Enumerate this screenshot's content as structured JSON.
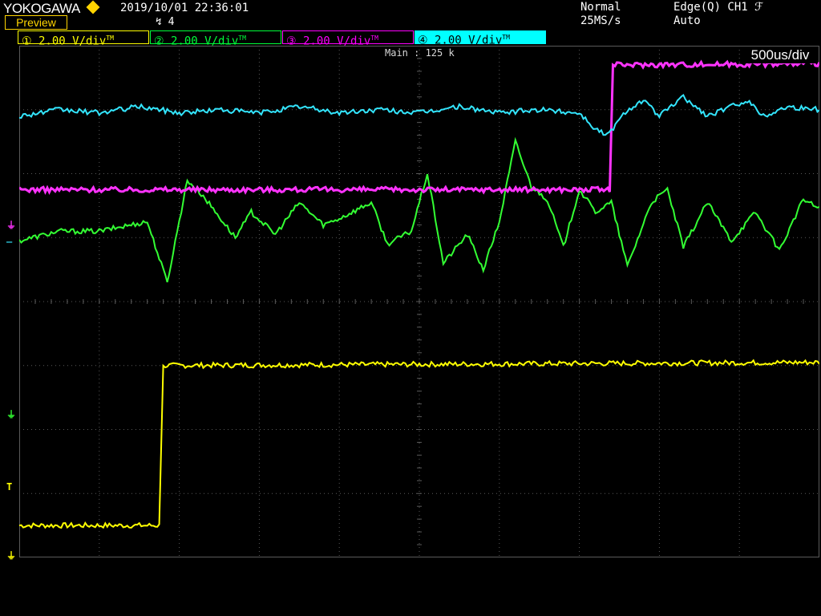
{
  "header": {
    "brand": "YOKOGAWA",
    "datetime": "2019/10/01 22:36:01",
    "mode_label": "Preview",
    "trigger_count": "↯ 4",
    "acq_mode": "Normal",
    "sample_rate": "25MS/s",
    "trigger_type": "Edge(Q) CH1 ℱ",
    "trigger_mode": "Auto"
  },
  "channels": [
    {
      "num": "①",
      "scale": "2.00 V/div",
      "color": "#ffff00"
    },
    {
      "num": "②",
      "scale": "2.00 V/div",
      "color": "#00ff3a"
    },
    {
      "num": "③",
      "scale": "2.00 V/div",
      "color": "#ff00ff"
    },
    {
      "num": "④",
      "scale": "2.00 V/div",
      "color": "#00ffff"
    }
  ],
  "channel_suffix": "TM",
  "display": {
    "main_label": "Main : 125 k",
    "time_div": "500us/div"
  },
  "colors": {
    "ch1": "#ffff00",
    "ch2": "#33ff33",
    "ch3": "#ff33ff",
    "ch4": "#33e6ff",
    "grid": "#5a5a5a",
    "brand": "#ffd400"
  },
  "chart_data": {
    "type": "line",
    "x_divisions": 10,
    "y_divisions": 8,
    "grid": true,
    "series": [
      {
        "x": [
          0,
          1.75,
          1.8,
          10
        ],
        "y": [
          -3.5,
          -3.5,
          -1.0,
          -0.95
        ]
      },
      {
        "x": [
          0,
          0.5,
          1.0,
          1.6,
          1.85,
          2.1,
          2.3,
          2.7,
          2.9,
          3.2,
          3.5,
          3.8,
          4.0,
          4.4,
          4.6,
          4.9,
          5.1,
          5.3,
          5.6,
          5.8,
          6.0,
          6.2,
          6.4,
          6.6,
          6.8,
          7.0,
          7.2,
          7.4,
          7.6,
          7.9,
          8.1,
          8.3,
          8.6,
          8.9,
          9.2,
          9.5,
          9.8,
          10
        ],
        "y": [
          0.95,
          1.1,
          1.1,
          1.25,
          0.3,
          1.9,
          1.65,
          1.0,
          1.4,
          1.05,
          1.55,
          1.2,
          1.3,
          1.55,
          0.9,
          1.1,
          2.0,
          0.6,
          1.05,
          0.5,
          1.25,
          2.5,
          1.8,
          1.6,
          0.85,
          1.75,
          1.4,
          1.55,
          0.55,
          1.55,
          1.75,
          0.85,
          1.55,
          0.95,
          1.4,
          0.8,
          1.6,
          1.45
        ]
      },
      {
        "x": [
          0,
          7.38,
          7.42,
          10
        ],
        "y": [
          1.75,
          1.75,
          3.7,
          3.72
        ]
      },
      {
        "x": [
          0,
          0.5,
          1,
          1.5,
          2,
          2.5,
          3,
          3.5,
          4,
          4.5,
          5,
          5.5,
          6,
          6.5,
          7,
          7.2,
          7.35,
          7.6,
          7.8,
          8.0,
          8.3,
          8.6,
          8.8,
          9.1,
          9.3,
          9.6,
          10
        ],
        "y": [
          2.9,
          3.0,
          2.95,
          3.05,
          2.95,
          3.0,
          2.95,
          3.05,
          2.95,
          3.0,
          2.95,
          3.05,
          2.95,
          3.0,
          2.95,
          2.7,
          2.6,
          3.0,
          3.15,
          2.9,
          3.2,
          2.9,
          3.0,
          3.15,
          2.9,
          3.05,
          3.0
        ]
      }
    ]
  }
}
